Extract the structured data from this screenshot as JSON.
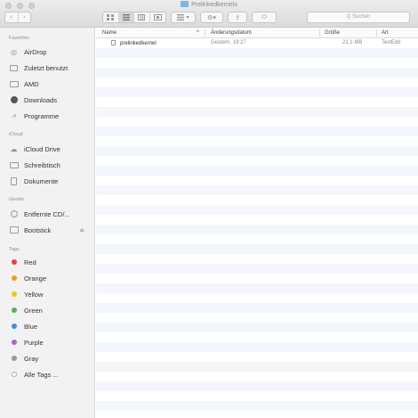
{
  "window": {
    "title": "Prelinkedkernels"
  },
  "toolbar": {
    "back_glyph": "‹",
    "forward_glyph": "›",
    "view_icons": [
      "icon-view-icon",
      "list-view-icon",
      "column-view-icon",
      "cover-flow-icon"
    ],
    "arrange_glyph": "▾",
    "action_glyph": "⚙▾",
    "share_glyph": "⇪",
    "tags_glyph": "⬭",
    "search_placeholder": "Q Suchen"
  },
  "sidebar": {
    "sections": [
      {
        "title": "Favoriten",
        "items": [
          {
            "label": "AirDrop",
            "icon": "airdrop-icon"
          },
          {
            "label": "Zuletzt benutzt",
            "icon": "recents-icon"
          },
          {
            "label": "AMD",
            "icon": "folder-icon"
          },
          {
            "label": "Downloads",
            "icon": "downloads-icon"
          },
          {
            "label": "Programme",
            "icon": "applications-icon"
          }
        ]
      },
      {
        "title": "iCloud",
        "items": [
          {
            "label": "iCloud Drive",
            "icon": "cloud-icon"
          },
          {
            "label": "Schreibtisch",
            "icon": "desktop-icon"
          },
          {
            "label": "Dokumente",
            "icon": "document-icon"
          }
        ]
      },
      {
        "title": "Geräte",
        "items": [
          {
            "label": "Entfernte CD/...",
            "icon": "disc-icon"
          },
          {
            "label": "Bootstick",
            "icon": "drive-icon"
          }
        ]
      },
      {
        "title": "Tags",
        "items": [
          {
            "label": "Red",
            "color": "#e8433a"
          },
          {
            "label": "Orange",
            "color": "#f39a1d"
          },
          {
            "label": "Yellow",
            "color": "#f5c518"
          },
          {
            "label": "Green",
            "color": "#4cbb4a"
          },
          {
            "label": "Blue",
            "color": "#3b8ee8"
          },
          {
            "label": "Purple",
            "color": "#b25fd6"
          },
          {
            "label": "Gray",
            "color": "#9a9a9a"
          },
          {
            "label": "Alle Tags ..."
          }
        ]
      }
    ],
    "eject_glyph": "⏏"
  },
  "columns": {
    "name": "Name",
    "sort_glyph": "^",
    "date": "Änderungsdatum",
    "size": "Größe",
    "kind": "Art"
  },
  "files": [
    {
      "name": "prelinkedkernel",
      "date": "Gestern, 19:27",
      "size": "21,1 MB",
      "kind": "TextEdit"
    }
  ]
}
